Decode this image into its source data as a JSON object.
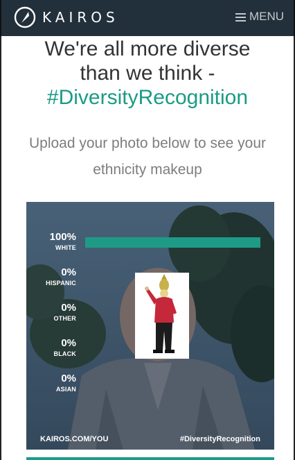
{
  "header": {
    "logo_text": "KAIROS",
    "menu_label": "MENU",
    "bg_color": "#22303b"
  },
  "hero": {
    "headline_line1": "We're all more diverse",
    "headline_line2": "than we think -",
    "hashtag": "#DiversityRecognition",
    "subtitle": "Upload your photo below to see your ethnicity makeup",
    "accent_color": "#1a9b86"
  },
  "result_card": {
    "rows": [
      {
        "percent": "100%",
        "label": "WHITE",
        "value": 1.0
      },
      {
        "percent": "0%",
        "label": "HISPANIC",
        "value": 0.0
      },
      {
        "percent": "0%",
        "label": "OTHER",
        "value": 0.0
      },
      {
        "percent": "0%",
        "label": "BLACK",
        "value": 0.0
      },
      {
        "percent": "0%",
        "label": "ASIAN",
        "value": 0.0
      }
    ],
    "footer_left": "KAIROS.COM/YOU",
    "footer_right": "#DiversityRecognition",
    "bar_color": "#1e9b86"
  }
}
